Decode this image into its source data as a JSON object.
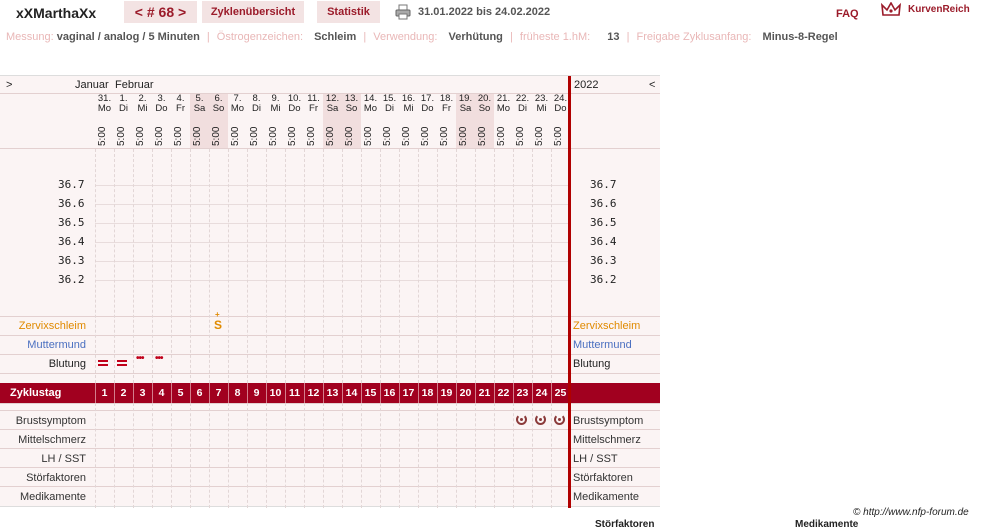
{
  "header": {
    "username": "xXMarthaXx",
    "cycle_label": "< # 68 >",
    "nav_overview": "Zyklenübersicht",
    "nav_stats": "Statistik",
    "date_range": "31.01.2022 bis 24.02.2022",
    "faq": "FAQ",
    "brand": "KurvenReich"
  },
  "info": {
    "messung_label": "Messung:",
    "messung_value": "vaginal / analog / 5 Minuten",
    "oestrogen_label": "Östrogenzeichen:",
    "oestrogen_value": "Schleim",
    "verwendung_label": "Verwendung:",
    "verwendung_value": "Verhütung",
    "frueheste_label": "früheste 1.hM:",
    "frueheste_value": "13",
    "freigabe_label": "Freigabe Zyklusanfang:",
    "freigabe_value": "Minus-8-Regel"
  },
  "chart": {
    "nav_left": ">",
    "nav_right": "<",
    "month1": "Januar",
    "month2": "Februar",
    "year": "2022",
    "days": [
      {
        "d": "31.",
        "w": "Mo",
        "we": false
      },
      {
        "d": "1.",
        "w": "Di",
        "we": false
      },
      {
        "d": "2.",
        "w": "Mi",
        "we": false
      },
      {
        "d": "3.",
        "w": "Do",
        "we": false
      },
      {
        "d": "4.",
        "w": "Fr",
        "we": false
      },
      {
        "d": "5.",
        "w": "Sa",
        "we": true
      },
      {
        "d": "6.",
        "w": "So",
        "we": true
      },
      {
        "d": "7.",
        "w": "Mo",
        "we": false
      },
      {
        "d": "8.",
        "w": "Di",
        "we": false
      },
      {
        "d": "9.",
        "w": "Mi",
        "we": false
      },
      {
        "d": "10.",
        "w": "Do",
        "we": false
      },
      {
        "d": "11.",
        "w": "Fr",
        "we": false
      },
      {
        "d": "12.",
        "w": "Sa",
        "we": true
      },
      {
        "d": "13.",
        "w": "So",
        "we": true
      },
      {
        "d": "14.",
        "w": "Mo",
        "we": false
      },
      {
        "d": "15.",
        "w": "Di",
        "we": false
      },
      {
        "d": "16.",
        "w": "Mi",
        "we": false
      },
      {
        "d": "17.",
        "w": "Do",
        "we": false
      },
      {
        "d": "18.",
        "w": "Fr",
        "we": false
      },
      {
        "d": "19.",
        "w": "Sa",
        "we": true
      },
      {
        "d": "20.",
        "w": "So",
        "we": true
      },
      {
        "d": "21.",
        "w": "Mo",
        "we": false
      },
      {
        "d": "22.",
        "w": "Di",
        "we": false
      },
      {
        "d": "23.",
        "w": "Mi",
        "we": false
      },
      {
        "d": "24.",
        "w": "Do",
        "we": false
      }
    ],
    "time": "5:00",
    "temps": [
      "36.7",
      "36.6",
      "36.5",
      "36.4",
      "36.3",
      "36.2"
    ],
    "row_zervix": "Zervixschleim",
    "row_muttermund": "Muttermund",
    "row_blutung": "Blutung",
    "row_zyklustag": "Zyklustag",
    "row_brust": "Brustsymptom",
    "row_mittel": "Mittelschmerz",
    "row_lh": "LH / SST",
    "row_stoer": "Störfaktoren",
    "row_medi": "Medikamente",
    "zervix_symbol": "S",
    "zervix_day_index": 6,
    "bleeding": [
      {
        "day": 0,
        "type": "heavy"
      },
      {
        "day": 1,
        "type": "heavy"
      },
      {
        "day": 2,
        "type": "light"
      },
      {
        "day": 3,
        "type": "light"
      }
    ],
    "breast_days": [
      22,
      23,
      24
    ],
    "cycle_days": [
      "1",
      "2",
      "3",
      "4",
      "5",
      "6",
      "7",
      "8",
      "9",
      "10",
      "11",
      "12",
      "13",
      "14",
      "15",
      "16",
      "17",
      "18",
      "19",
      "20",
      "21",
      "22",
      "23",
      "24",
      "25"
    ]
  },
  "footer": {
    "copyright": "© http://www.nfp-forum.de",
    "cut1": "Störfaktoren",
    "cut2": "Medikamente"
  },
  "colors": {
    "accent": "#a1001f",
    "zervix": "#e08a00",
    "muttermund": "#4a6fc0"
  }
}
